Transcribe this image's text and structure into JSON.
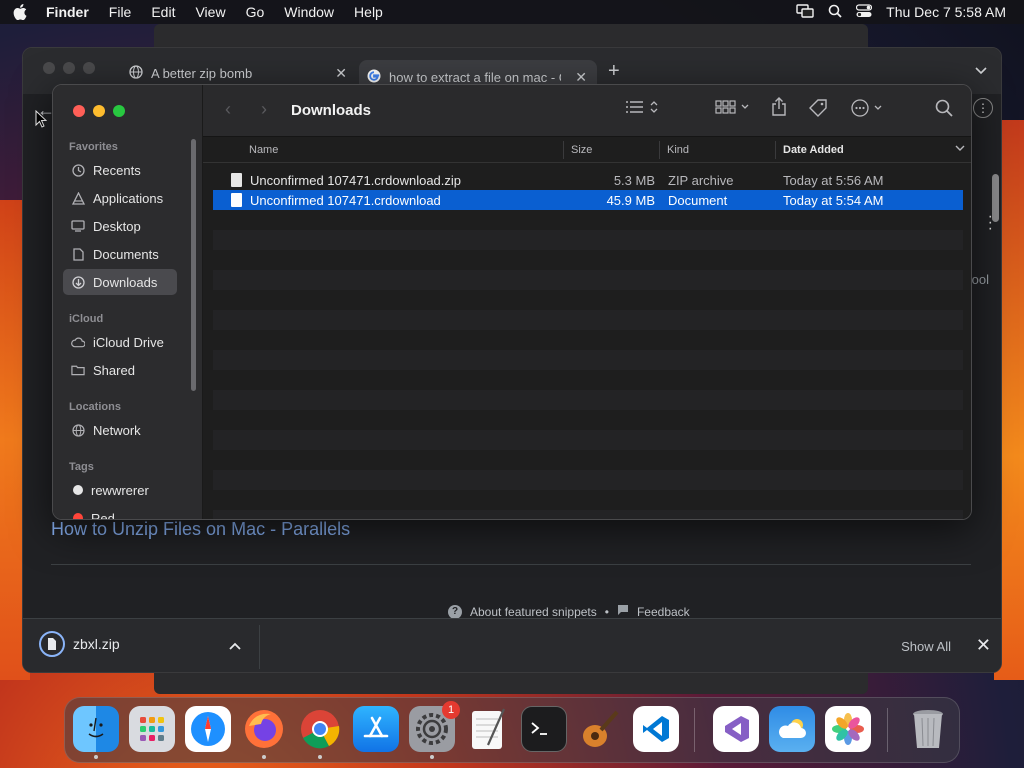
{
  "menubar": {
    "app_name": "Finder",
    "menus": [
      "File",
      "Edit",
      "View",
      "Go",
      "Window",
      "Help"
    ],
    "clock": "Thu Dec 7  5:58 AM",
    "icons": [
      "apple-icon",
      "screen-mirroring-icon",
      "spotlight-search-icon",
      "control-center-icon"
    ]
  },
  "browser": {
    "tabs": [
      {
        "title": "A better zip bomb",
        "icon": "globe-icon",
        "active": false
      },
      {
        "title": "how to extract a file on mac - G",
        "icon": "google-icon",
        "active": true
      }
    ],
    "new_tab": "+",
    "page": {
      "snippet_link": "How to Unzip Files on Mac - Parallels",
      "about_snippets": "About featured snippets",
      "bullet": "•",
      "feedback": "Feedback",
      "side_text": "ool"
    },
    "download_bar": {
      "file": "zbxl.zip",
      "show_all": "Show All"
    }
  },
  "finder": {
    "title": "Downloads",
    "sidebar": {
      "favorites_header": "Favorites",
      "favorites": [
        {
          "label": "Recents",
          "icon": "clock-icon"
        },
        {
          "label": "Applications",
          "icon": "applications-icon"
        },
        {
          "label": "Desktop",
          "icon": "desktop-icon"
        },
        {
          "label": "Documents",
          "icon": "document-icon"
        },
        {
          "label": "Downloads",
          "icon": "download-icon",
          "selected": true
        }
      ],
      "icloud_header": "iCloud",
      "icloud": [
        {
          "label": "iCloud Drive",
          "icon": "cloud-icon"
        },
        {
          "label": "Shared",
          "icon": "shared-folder-icon"
        }
      ],
      "locations_header": "Locations",
      "locations": [
        {
          "label": "Network",
          "icon": "globe-icon"
        }
      ],
      "tags_header": "Tags",
      "tags": [
        {
          "label": "rewwrerer",
          "color": "#e6e6e6"
        },
        {
          "label": "Red",
          "color": "#ff453a"
        }
      ]
    },
    "columns": {
      "name": "Name",
      "size": "Size",
      "kind": "Kind",
      "date": "Date Added"
    },
    "files": [
      {
        "name": "Unconfirmed 107471.crdownload.zip",
        "size": "5.3 MB",
        "kind": "ZIP archive",
        "date": "Today at 5:56 AM",
        "selected": false
      },
      {
        "name": "Unconfirmed 107471.crdownload",
        "size": "45.9 MB",
        "kind": "Document",
        "date": "Today at 5:54 AM",
        "selected": true
      }
    ]
  },
  "dock": {
    "apps": [
      "Finder",
      "Launchpad",
      "Safari",
      "Firefox",
      "Chrome",
      "App Store",
      "System Settings",
      "TextEdit",
      "Terminal",
      "GarageBand",
      "Visual Studio Code",
      "Visual Studio",
      "Weather",
      "Photos",
      "Trash"
    ],
    "system_settings_badge": "1"
  },
  "colors": {
    "selection": "#0a5fd1",
    "close": "#ff5f57",
    "minimize": "#febc2e",
    "zoom": "#28c840",
    "link": "#8ab4f8"
  }
}
